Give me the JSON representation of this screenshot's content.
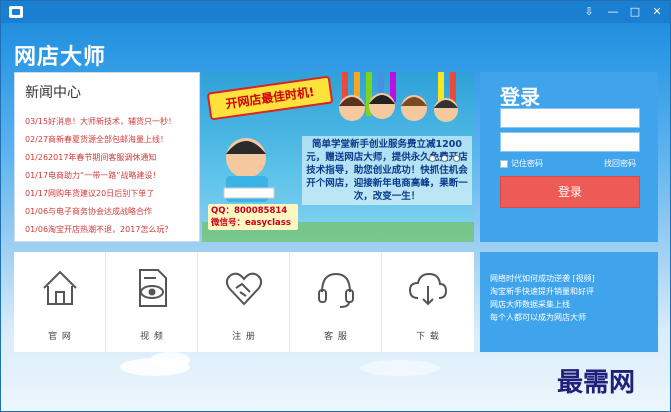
{
  "window": {
    "app_title": "网店大师",
    "controls": {
      "menu": "⇩",
      "minimize": "—",
      "maximize": "□",
      "close": "✕"
    }
  },
  "news": {
    "title": "新闻中心",
    "items": [
      "03/15好消息！大师新技术，辅货只一秒！",
      "02/27商新春夏货源全部包邮海量上线！",
      "01/262017年春节期间客服调休通知",
      "01/17电商助力“一带一路”战略建设！",
      "01/17网购年货建议20日后别下单了",
      "01/06与电子商务协会达成战略合作",
      "01/06淘宝开店热潮不退，2017怎么玩？"
    ]
  },
  "banner": {
    "tag": "开网店最佳时机!",
    "text": "简单学堂新手创业服务费立减1200元，赠送网店大师，提供永久免费开店技术指导，助您创业成功！快抓住机会开个网店，迎接新年电商高峰，果断一次，改变一生！",
    "qq": "QQ：800085814",
    "wechat": "微信号：easyclass"
  },
  "login": {
    "title": "登录",
    "username_placeholder": "",
    "password_placeholder": "",
    "remember_label": "记住密码",
    "forgot_label": "找回密码",
    "login_button": "登录"
  },
  "tiles": [
    {
      "label": "官 网",
      "icon": "home-icon"
    },
    {
      "label": "视 频",
      "icon": "video-icon"
    },
    {
      "label": "注 册",
      "icon": "handshake-icon"
    },
    {
      "label": "客 服",
      "icon": "headset-icon"
    },
    {
      "label": "下 载",
      "icon": "cloud-download-icon"
    }
  ],
  "links": [
    "网络时代如何成功逆袭 [视频]",
    "淘宝新手快速提升销量和好评",
    "网店大师数据采集上线",
    "每个人都可以成为网店大师"
  ],
  "watermark": "最需网",
  "colors": {
    "brand_blue": "#1a7fd0",
    "panel_blue": "#3fa4ec",
    "login_red": "#ee5a56",
    "news_red": "#d23a3a"
  }
}
